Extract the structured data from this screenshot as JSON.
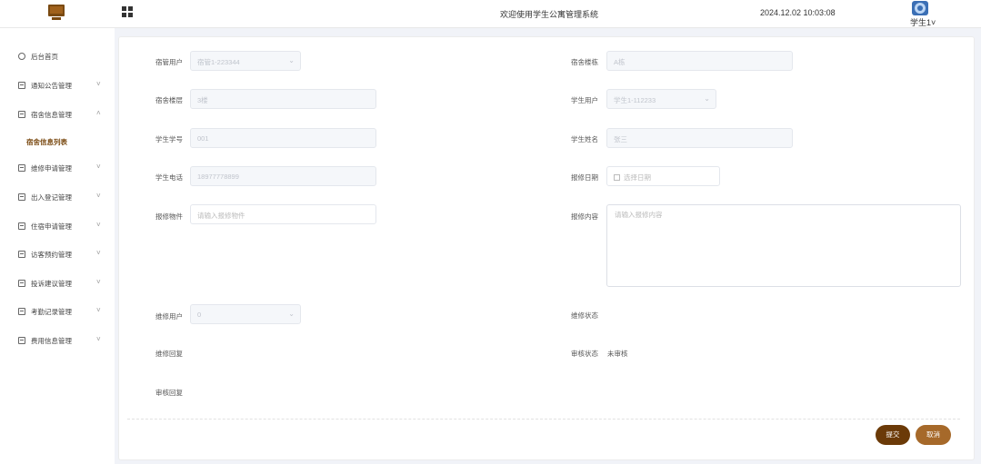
{
  "header": {
    "title": "欢迎使用学生公寓管理系统",
    "time": "2024.12.02 10:03:08",
    "user": "学生1",
    "user_chevron": "˅"
  },
  "sidebar": {
    "items": [
      {
        "label": "后台首页",
        "icon": "clock-icon"
      },
      {
        "label": "通知公告管理",
        "icon": "box-icon",
        "chevron": "˅"
      },
      {
        "label": "宿舍信息管理",
        "icon": "box-icon",
        "chevron": "˄"
      },
      {
        "label": "维修申请管理",
        "icon": "box-icon",
        "chevron": "˅"
      },
      {
        "label": "出入登记管理",
        "icon": "box-icon",
        "chevron": "˅"
      },
      {
        "label": "住宿申请管理",
        "icon": "box-icon",
        "chevron": "˅"
      },
      {
        "label": "访客预约管理",
        "icon": "box-icon",
        "chevron": "˅"
      },
      {
        "label": "投诉建议管理",
        "icon": "box-icon",
        "chevron": "˅"
      },
      {
        "label": "考勤记录管理",
        "icon": "box-icon",
        "chevron": "˅"
      },
      {
        "label": "费用信息管理",
        "icon": "box-icon",
        "chevron": "˅"
      }
    ],
    "sub_item": "宿舍信息列表"
  },
  "form": {
    "dorm_user_label": "宿管用户",
    "dorm_user_value": "宿管1-223344",
    "building_label": "宿舍楼栋",
    "building_value": "A栋",
    "floor_label": "宿舍楼层",
    "floor_value": "3楼",
    "student_user_label": "学生用户",
    "student_user_value": "学生1-112233",
    "student_no_label": "学生学号",
    "student_no_value": "001",
    "student_name_label": "学生姓名",
    "student_name_value": "张三",
    "phone_label": "学生电话",
    "phone_value": "18977778899",
    "repair_date_label": "报修日期",
    "repair_date_placeholder": "选择日期",
    "repair_item_label": "报修物件",
    "repair_item_placeholder": "请输入报修物件",
    "repair_content_label": "报修内容",
    "repair_content_placeholder": "请输入报修内容",
    "repair_user_label": "维修用户",
    "repair_user_value": "0",
    "repair_status_label": "维修状态",
    "repair_reply_label": "维修回复",
    "audit_status_label": "审核状态",
    "audit_status_value": "未审核",
    "audit_reply_label": "审核回复"
  },
  "buttons": {
    "submit": "提交",
    "cancel": "取消"
  },
  "colors": {
    "accent_dark": "#6b3a08",
    "accent": "#a6692a",
    "active_menu": "#7a4a12"
  }
}
